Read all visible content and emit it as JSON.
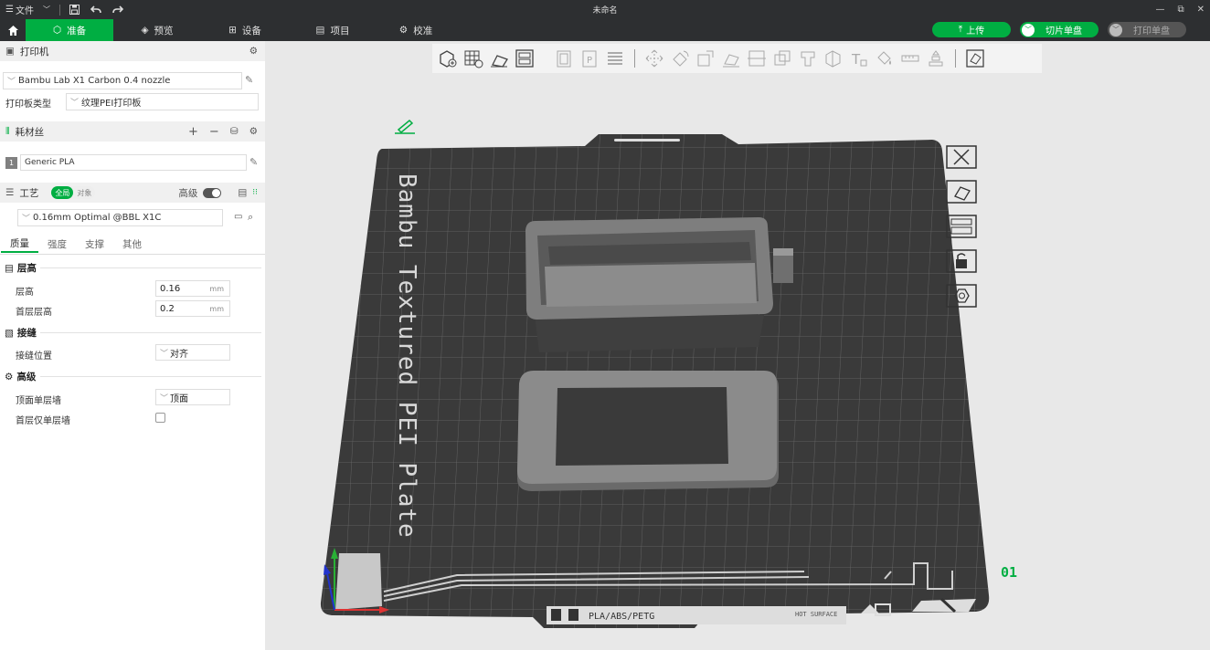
{
  "titlebar": {
    "menu_label": "文件",
    "title": "未命名"
  },
  "nav": {
    "tabs": [
      {
        "label": "准备"
      },
      {
        "label": "预览"
      },
      {
        "label": "设备"
      },
      {
        "label": "项目"
      },
      {
        "label": "校准"
      }
    ],
    "upload_label": "上传",
    "slice_label": "切片单盘",
    "print_label": "打印单盘"
  },
  "printer": {
    "section_title": "打印机",
    "preset": "Bambu Lab X1 Carbon 0.4 nozzle",
    "plate_type_label": "打印板类型",
    "plate_type": "纹理PEI打印板"
  },
  "filament": {
    "section_title": "耗材丝",
    "items": [
      {
        "index": "1",
        "name": "Generic PLA",
        "color": "#808080"
      }
    ]
  },
  "process": {
    "section_title": "工艺",
    "global_label": "全局",
    "object_label": "对象",
    "advanced_label": "高级",
    "preset": "0.16mm Optimal @BBL X1C",
    "tabs": [
      {
        "label": "质量"
      },
      {
        "label": "强度"
      },
      {
        "label": "支撑"
      },
      {
        "label": "其他"
      }
    ],
    "groups": {
      "layer_height": {
        "title": "层高",
        "rows": [
          {
            "label": "层高",
            "value": "0.16",
            "unit": "mm"
          },
          {
            "label": "首层层高",
            "value": "0.2",
            "unit": "mm"
          }
        ]
      },
      "seam": {
        "title": "接缝",
        "rows": [
          {
            "label": "接缝位置",
            "value": "对齐"
          }
        ]
      },
      "advanced": {
        "title": "高级",
        "rows": [
          {
            "label": "顶面单层墙",
            "value": "顶面"
          },
          {
            "label": "首层仅单层墙",
            "checked": false
          }
        ]
      }
    }
  },
  "plate": {
    "bed_text": "Bambu Textured PEI Plate",
    "material_text": "PLA/ABS/PETG",
    "hot_surface_text": "HOT SURFACE",
    "number": "01"
  },
  "colors": {
    "accent": "#00ae42",
    "bar": "#2d2f31",
    "bed": "#3a3a3a"
  }
}
